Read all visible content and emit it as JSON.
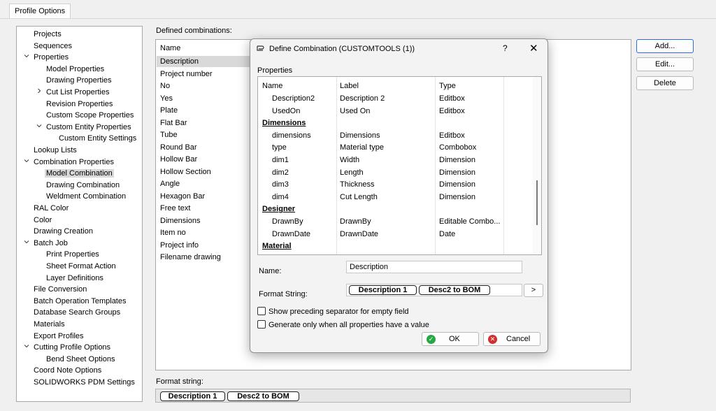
{
  "tabs": [
    {
      "label": "Profile Options"
    }
  ],
  "tree": {
    "items": [
      {
        "label": "Projects",
        "level": 0,
        "expander": ""
      },
      {
        "label": "Sequences",
        "level": 0,
        "expander": ""
      },
      {
        "label": "Properties",
        "level": 0,
        "expander": "down"
      },
      {
        "label": "Model Properties",
        "level": 1,
        "expander": ""
      },
      {
        "label": "Drawing Properties",
        "level": 1,
        "expander": ""
      },
      {
        "label": "Cut List Properties",
        "level": 1,
        "expander": "right"
      },
      {
        "label": "Revision Properties",
        "level": 1,
        "expander": ""
      },
      {
        "label": "Custom Scope Properties",
        "level": 1,
        "expander": ""
      },
      {
        "label": "Custom Entity Properties",
        "level": 1,
        "expander": "down"
      },
      {
        "label": "Custom Entity Settings",
        "level": 2,
        "expander": ""
      },
      {
        "label": "Lookup Lists",
        "level": 0,
        "expander": ""
      },
      {
        "label": "Combination Properties",
        "level": 0,
        "expander": "down"
      },
      {
        "label": "Model Combination",
        "level": 1,
        "expander": "",
        "selected": true
      },
      {
        "label": "Drawing Combination",
        "level": 1,
        "expander": ""
      },
      {
        "label": "Weldment Combination",
        "level": 1,
        "expander": ""
      },
      {
        "label": "RAL Color",
        "level": 0,
        "expander": ""
      },
      {
        "label": "Color",
        "level": 0,
        "expander": ""
      },
      {
        "label": "Drawing Creation",
        "level": 0,
        "expander": ""
      },
      {
        "label": "Batch Job",
        "level": 0,
        "expander": "down"
      },
      {
        "label": "Print Properties",
        "level": 1,
        "expander": ""
      },
      {
        "label": "Sheet Format Action",
        "level": 1,
        "expander": ""
      },
      {
        "label": "Layer Definitions",
        "level": 1,
        "expander": ""
      },
      {
        "label": "File Conversion",
        "level": 0,
        "expander": ""
      },
      {
        "label": "Batch Operation Templates",
        "level": 0,
        "expander": ""
      },
      {
        "label": "Database Search Groups",
        "level": 0,
        "expander": ""
      },
      {
        "label": "Materials",
        "level": 0,
        "expander": ""
      },
      {
        "label": "Export Profiles",
        "level": 0,
        "expander": ""
      },
      {
        "label": "Cutting Profile Options",
        "level": 0,
        "expander": "down"
      },
      {
        "label": "Bend Sheet Options",
        "level": 1,
        "expander": ""
      },
      {
        "label": "Coord Note Options",
        "level": 0,
        "expander": ""
      },
      {
        "label": "SOLIDWORKS PDM Settings",
        "level": 0,
        "expander": ""
      }
    ]
  },
  "combinations": {
    "label": "Defined combinations:",
    "column": "Name",
    "items": [
      {
        "label": "Description",
        "selected": true
      },
      {
        "label": "Project number"
      },
      {
        "label": "No"
      },
      {
        "label": "Yes"
      },
      {
        "label": "Plate"
      },
      {
        "label": "Flat Bar"
      },
      {
        "label": "Tube"
      },
      {
        "label": "Round Bar"
      },
      {
        "label": "Hollow Bar"
      },
      {
        "label": "Hollow Section"
      },
      {
        "label": "Angle"
      },
      {
        "label": "Hexagon Bar"
      },
      {
        "label": "Free text"
      },
      {
        "label": "Dimensions"
      },
      {
        "label": "Item no"
      },
      {
        "label": "Project info"
      },
      {
        "label": "Filename drawing"
      }
    ]
  },
  "format_string": {
    "label": "Format string:",
    "chips": [
      "Description 1",
      "Desc2 to BOM"
    ]
  },
  "buttons": {
    "add": "Add...",
    "edit": "Edit...",
    "delete": "Delete"
  },
  "dialog": {
    "title": "Define Combination (CUSTOMTOOLS (1))",
    "help": "?",
    "close": "✕",
    "properties_label": "Properties",
    "columns": [
      "Name",
      "Label",
      "Type"
    ],
    "rows": [
      {
        "name": "Description2",
        "label": "Description 2",
        "type": "Editbox"
      },
      {
        "name": "UsedOn",
        "label": "Used On",
        "type": "Editbox"
      },
      {
        "group": "Dimensions"
      },
      {
        "name": "dimensions",
        "label": "Dimensions",
        "type": "Editbox"
      },
      {
        "name": "type",
        "label": "Material type",
        "type": "Combobox"
      },
      {
        "name": "dim1",
        "label": "Width",
        "type": "Dimension"
      },
      {
        "name": "dim2",
        "label": "Length",
        "type": "Dimension"
      },
      {
        "name": "dim3",
        "label": "Thickness",
        "type": "Dimension"
      },
      {
        "name": "dim4",
        "label": "Cut Length",
        "type": "Dimension"
      },
      {
        "group": "Designer"
      },
      {
        "name": "DrawnBy",
        "label": "DrawnBy",
        "type": "Editable Combo..."
      },
      {
        "name": "DrawnDate",
        "label": "DrawnDate",
        "type": "Date"
      },
      {
        "group": "Material"
      }
    ],
    "name_label": "Name:",
    "name_value": "Description",
    "format_label": "Format String:",
    "format_chips": [
      "Description 1",
      "Desc2 to BOM"
    ],
    "format_more": ">",
    "check1": "Show preceding separator for empty field",
    "check2": "Generate only when all properties have a value",
    "ok": "OK",
    "cancel": "Cancel"
  },
  "colors": {
    "accent": "#2a6fd6",
    "selection": "#d9d9d9",
    "ok": "#28a745",
    "cancel": "#d32f2f"
  }
}
